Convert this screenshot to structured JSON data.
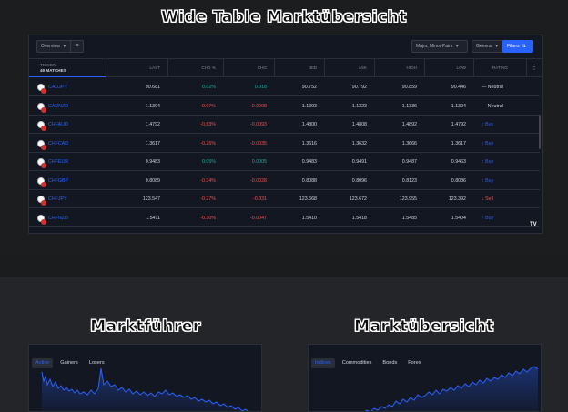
{
  "headings": {
    "main": "Wide Table Marktübersicht",
    "left": "Marktführer",
    "right": "Marktübersicht"
  },
  "toolbar": {
    "overview_label": "Overview",
    "list_icon": "list-icon",
    "pairs_label": "Major, Minor Pairs",
    "general_label": "General",
    "filters_label": "Filters"
  },
  "table": {
    "ticker_header": "TICKER",
    "matches": "49 MATCHES",
    "columns": [
      "LAST",
      "CHG %",
      "CHG",
      "BID",
      "ASK",
      "HIGH",
      "LOW",
      "RATING"
    ],
    "rows": [
      {
        "symbol": "CADJPY",
        "last": "90.681",
        "chg_pct": "0.02%",
        "chg": "0.018",
        "bid": "90.752",
        "ask": "90.792",
        "high": "90.859",
        "low": "90.446",
        "rating": "— Neutral",
        "dir": "up",
        "rating_type": "neutral"
      },
      {
        "symbol": "CADNZD",
        "last": "1.1304",
        "chg_pct": "-0.07%",
        "chg": "-0.0008",
        "bid": "1.1303",
        "ask": "1.1323",
        "high": "1.1336",
        "low": "1.1304",
        "rating": "— Neutral",
        "dir": "down",
        "rating_type": "neutral"
      },
      {
        "symbol": "CHFAUD",
        "last": "1.4792",
        "chg_pct": "-0.63%",
        "chg": "-0.0093",
        "bid": "1.4800",
        "ask": "1.4808",
        "high": "1.4892",
        "low": "1.4792",
        "rating": "↑ Buy",
        "dir": "down",
        "rating_type": "buy"
      },
      {
        "symbol": "CHFCAD",
        "last": "1.3617",
        "chg_pct": "-0.26%",
        "chg": "-0.0035",
        "bid": "1.3616",
        "ask": "1.3632",
        "high": "1.3666",
        "low": "1.3617",
        "rating": "↑ Buy",
        "dir": "down",
        "rating_type": "buy"
      },
      {
        "symbol": "CHFEUR",
        "last": "0.9483",
        "chg_pct": "0.05%",
        "chg": "0.0005",
        "bid": "0.9483",
        "ask": "0.9491",
        "high": "0.9487",
        "low": "0.9463",
        "rating": "↑ Buy",
        "dir": "up",
        "rating_type": "buy"
      },
      {
        "symbol": "CHFGBP",
        "last": "0.8089",
        "chg_pct": "-0.34%",
        "chg": "-0.0028",
        "bid": "0.8088",
        "ask": "0.8096",
        "high": "0.8123",
        "low": "0.8086",
        "rating": "↑ Buy",
        "dir": "down",
        "rating_type": "buy"
      },
      {
        "symbol": "CHFJPY",
        "last": "123.547",
        "chg_pct": "-0.27%",
        "chg": "-0.331",
        "bid": "123.668",
        "ask": "123.672",
        "high": "123.955",
        "low": "123.392",
        "rating": "↓ Sell",
        "dir": "down",
        "rating_type": "sell"
      },
      {
        "symbol": "CHFNZD",
        "last": "1.5411",
        "chg_pct": "-0.30%",
        "chg": "-0.0047",
        "bid": "1.5410",
        "ask": "1.5418",
        "high": "1.5485",
        "low": "1.5404",
        "rating": "↑ Buy",
        "dir": "down",
        "rating_type": "buy"
      }
    ]
  },
  "leaders": {
    "tabs": [
      "Active",
      "Gainers",
      "Losers"
    ],
    "active_tab": "Active"
  },
  "overview": {
    "tabs": [
      "Indices",
      "Commodities",
      "Bonds",
      "Forex"
    ],
    "active_tab": "Indices"
  },
  "colors": {
    "accent": "#2962ff",
    "up": "#26a69a",
    "down": "#ef5350",
    "panel": "#131722"
  }
}
